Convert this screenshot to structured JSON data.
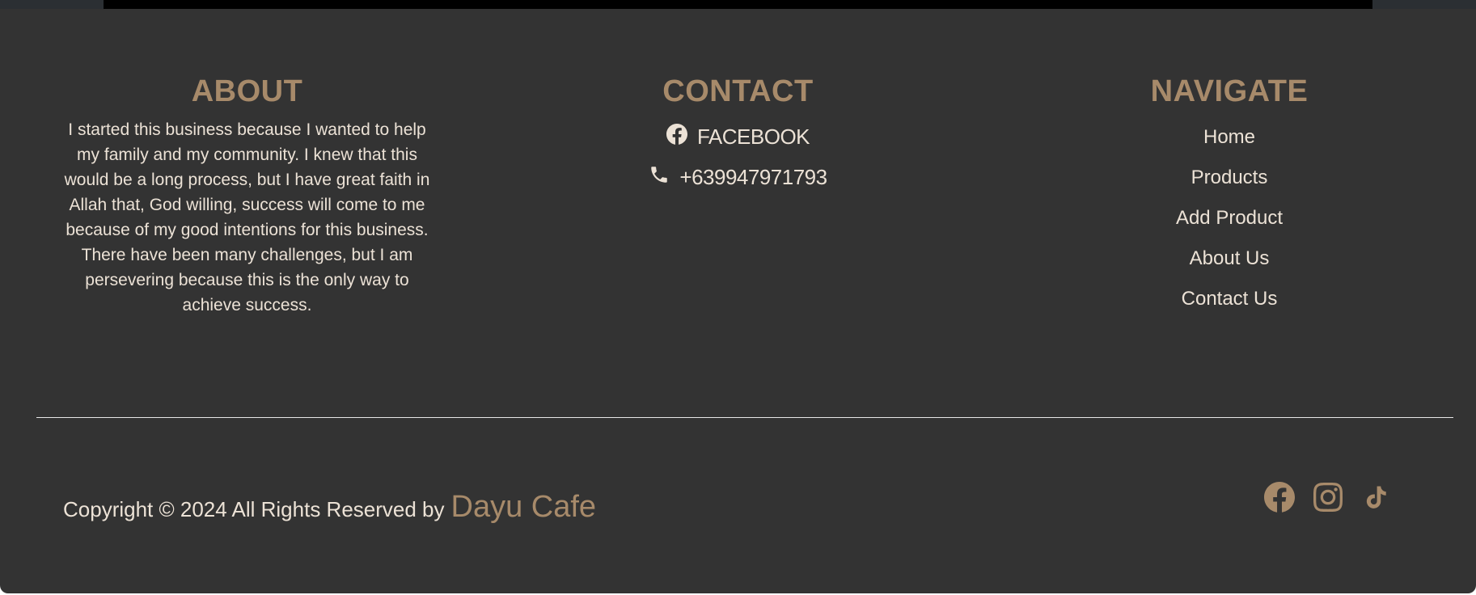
{
  "about": {
    "title": "ABOUT",
    "text": "I started this business because I wanted to help my family and my community. I knew that this would be a long process, but I have great faith in Allah that, God willing, success will come to me because of my good intentions for this business. There have been many challenges, but I am persevering because this is the only way to achieve success."
  },
  "contact": {
    "title": "CONTACT",
    "items": [
      {
        "icon": "facebook-icon",
        "label": "FACEBOOK"
      },
      {
        "icon": "phone-icon",
        "label": "+639947971793"
      }
    ]
  },
  "navigate": {
    "title": "NAVIGATE",
    "items": [
      "Home",
      "Products",
      "Add Product",
      "About Us",
      "Contact Us"
    ]
  },
  "footer": {
    "copyright": "Copyright © 2024 All Rights Reserved by",
    "brand": "Dayu Cafe",
    "socials": [
      "facebook-icon",
      "instagram-icon",
      "tiktok-icon"
    ]
  },
  "colors": {
    "background": "#333333",
    "accent": "#a78a6a",
    "text": "#ece2d6"
  }
}
